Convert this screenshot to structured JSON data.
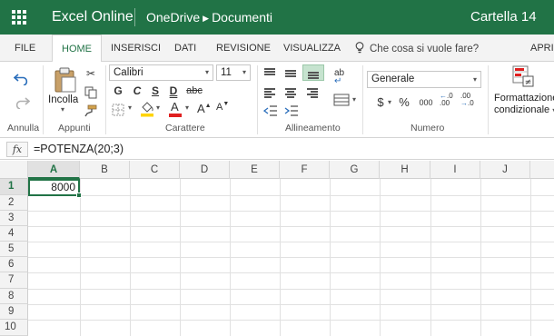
{
  "app": {
    "name": "Excel Online",
    "breadcrumb": [
      "OneDrive",
      "Documenti"
    ],
    "document_title": "Cartella 14",
    "accent": "#217346"
  },
  "ribbon_tabs": [
    "FILE",
    "HOME",
    "INSERISCI",
    "DATI",
    "REVISIONE",
    "VISUALIZZA",
    "APRI"
  ],
  "tell_me": "Che cosa si vuole fare?",
  "ribbon": {
    "groups": [
      "Annulla",
      "Appunti",
      "Carattere",
      "Allineamento",
      "Numero"
    ],
    "paste_label": "Incolla",
    "font_name": "Calibri",
    "font_size": "11",
    "bold": "G",
    "italic": "C",
    "underline": "S",
    "double_underline": "D",
    "strike": "abc",
    "grow_font": "A",
    "shrink_font": "A",
    "font_color_letter": "A",
    "number_format": "Generale",
    "currency": "$",
    "percent": "%",
    "comma": "000",
    "conditional_formatting": [
      "Formattazione",
      "condizionale"
    ]
  },
  "formula_bar": {
    "fx": "fx",
    "formula": "=POTENZA(20;3)"
  },
  "sheet": {
    "columns": [
      "A",
      "B",
      "C",
      "D",
      "E",
      "F",
      "G",
      "H",
      "I",
      "J"
    ],
    "rows": [
      "1",
      "2",
      "3",
      "4",
      "5",
      "6",
      "7",
      "8",
      "9",
      "10"
    ],
    "active_cell": "A1",
    "a1_value": "8000"
  },
  "icons": [
    "app-launcher-icon",
    "undo-icon",
    "redo-icon",
    "cut-icon",
    "copy-icon",
    "format-painter-icon",
    "lightbulb-icon",
    "borders-icon",
    "fill-color-icon",
    "wrap-text-icon",
    "merge-icon",
    "increase-decimal-icon",
    "decrease-decimal-icon"
  ]
}
